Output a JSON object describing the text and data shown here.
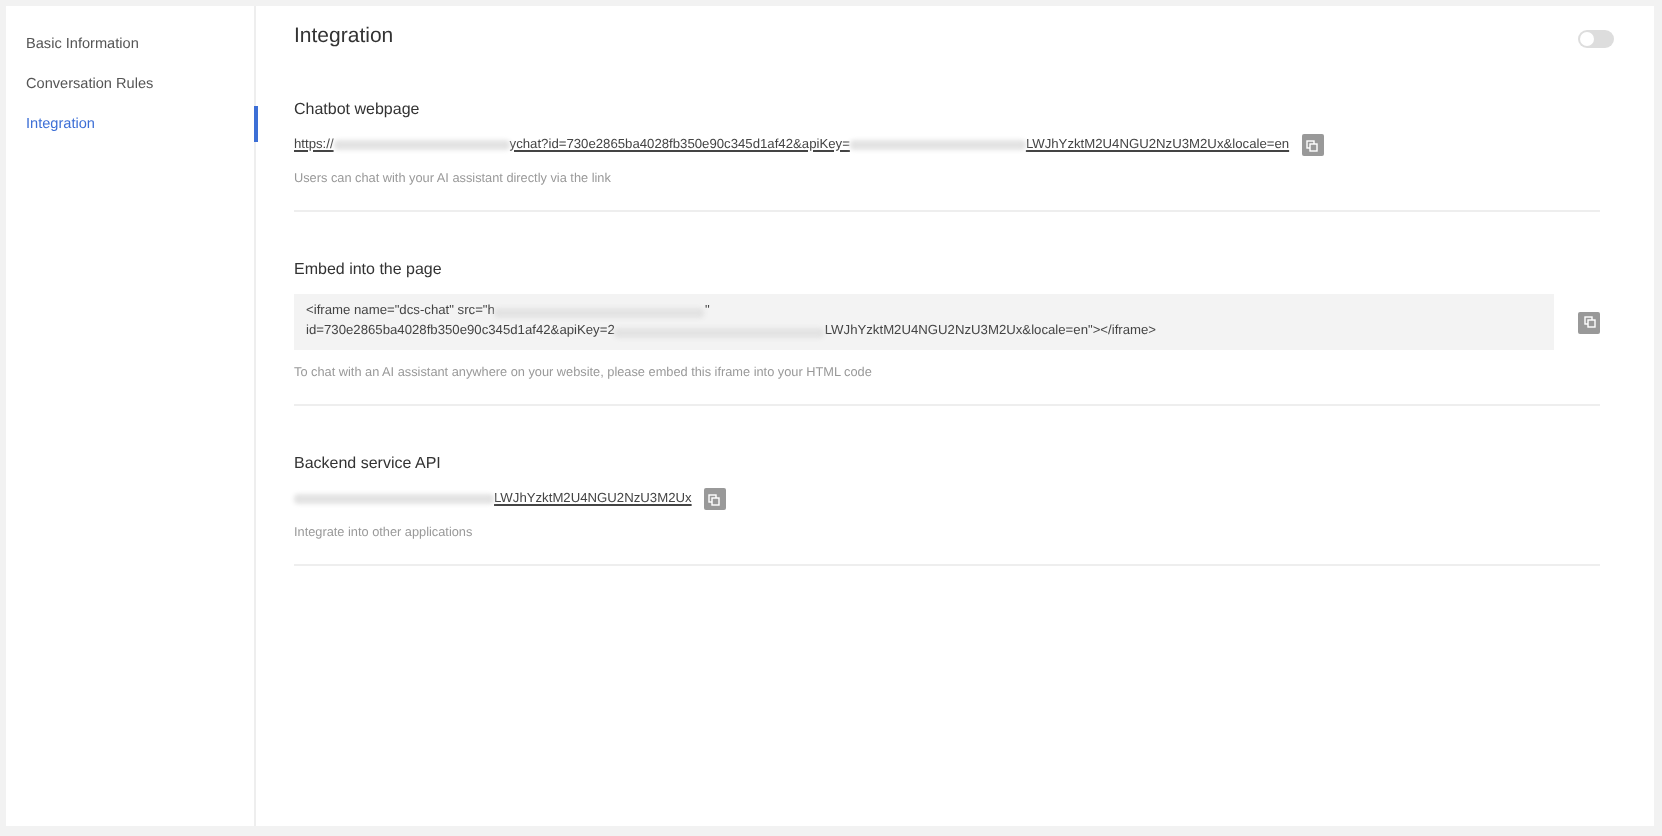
{
  "sidebar": {
    "items": [
      {
        "label": "Basic Information",
        "selected": false
      },
      {
        "label": "Conversation Rules",
        "selected": false
      },
      {
        "label": "Integration",
        "selected": true
      }
    ]
  },
  "header": {
    "title": "Integration",
    "toggle": {
      "on": false
    }
  },
  "sections": [
    {
      "kind": "link",
      "title": "Chatbot webpage",
      "lines": [
        [
          {
            "kind": "text",
            "text": "https://"
          },
          {
            "kind": "redacted"
          },
          {
            "kind": "text",
            "text": "ychat?id=730e2865ba4028fb350e90c345d1af42&apiKey="
          },
          {
            "kind": "redacted"
          },
          {
            "kind": "text",
            "text": "LWJhYzktM2U4NGU2NzU3M2Ux&locale=en"
          }
        ]
      ],
      "description": "Users can chat with your AI assistant directly via the link"
    },
    {
      "kind": "code",
      "title": "Embed into the page",
      "lines": [
        [
          {
            "kind": "text",
            "text": "<iframe name=\"dcs-chat\" src=\"h"
          },
          {
            "kind": "redacted"
          },
          {
            "kind": "text",
            "text": "\""
          }
        ],
        [
          {
            "kind": "text",
            "text": "id=730e2865ba4028fb350e90c345d1af42&apiKey=2"
          },
          {
            "kind": "redacted"
          },
          {
            "kind": "text",
            "text": "LWJhYzktM2U4NGU2NzU3M2Ux&locale=en\"></iframe>"
          }
        ]
      ],
      "description": "To chat with an AI assistant anywhere on your website, please embed this iframe into your HTML code"
    },
    {
      "kind": "link",
      "title": "Backend service API",
      "lines": [
        [
          {
            "kind": "redacted"
          },
          {
            "kind": "text",
            "text": "LWJhYzktM2U4NGU2NzU3M2Ux"
          }
        ]
      ],
      "description": "Integrate into other applications"
    }
  ]
}
